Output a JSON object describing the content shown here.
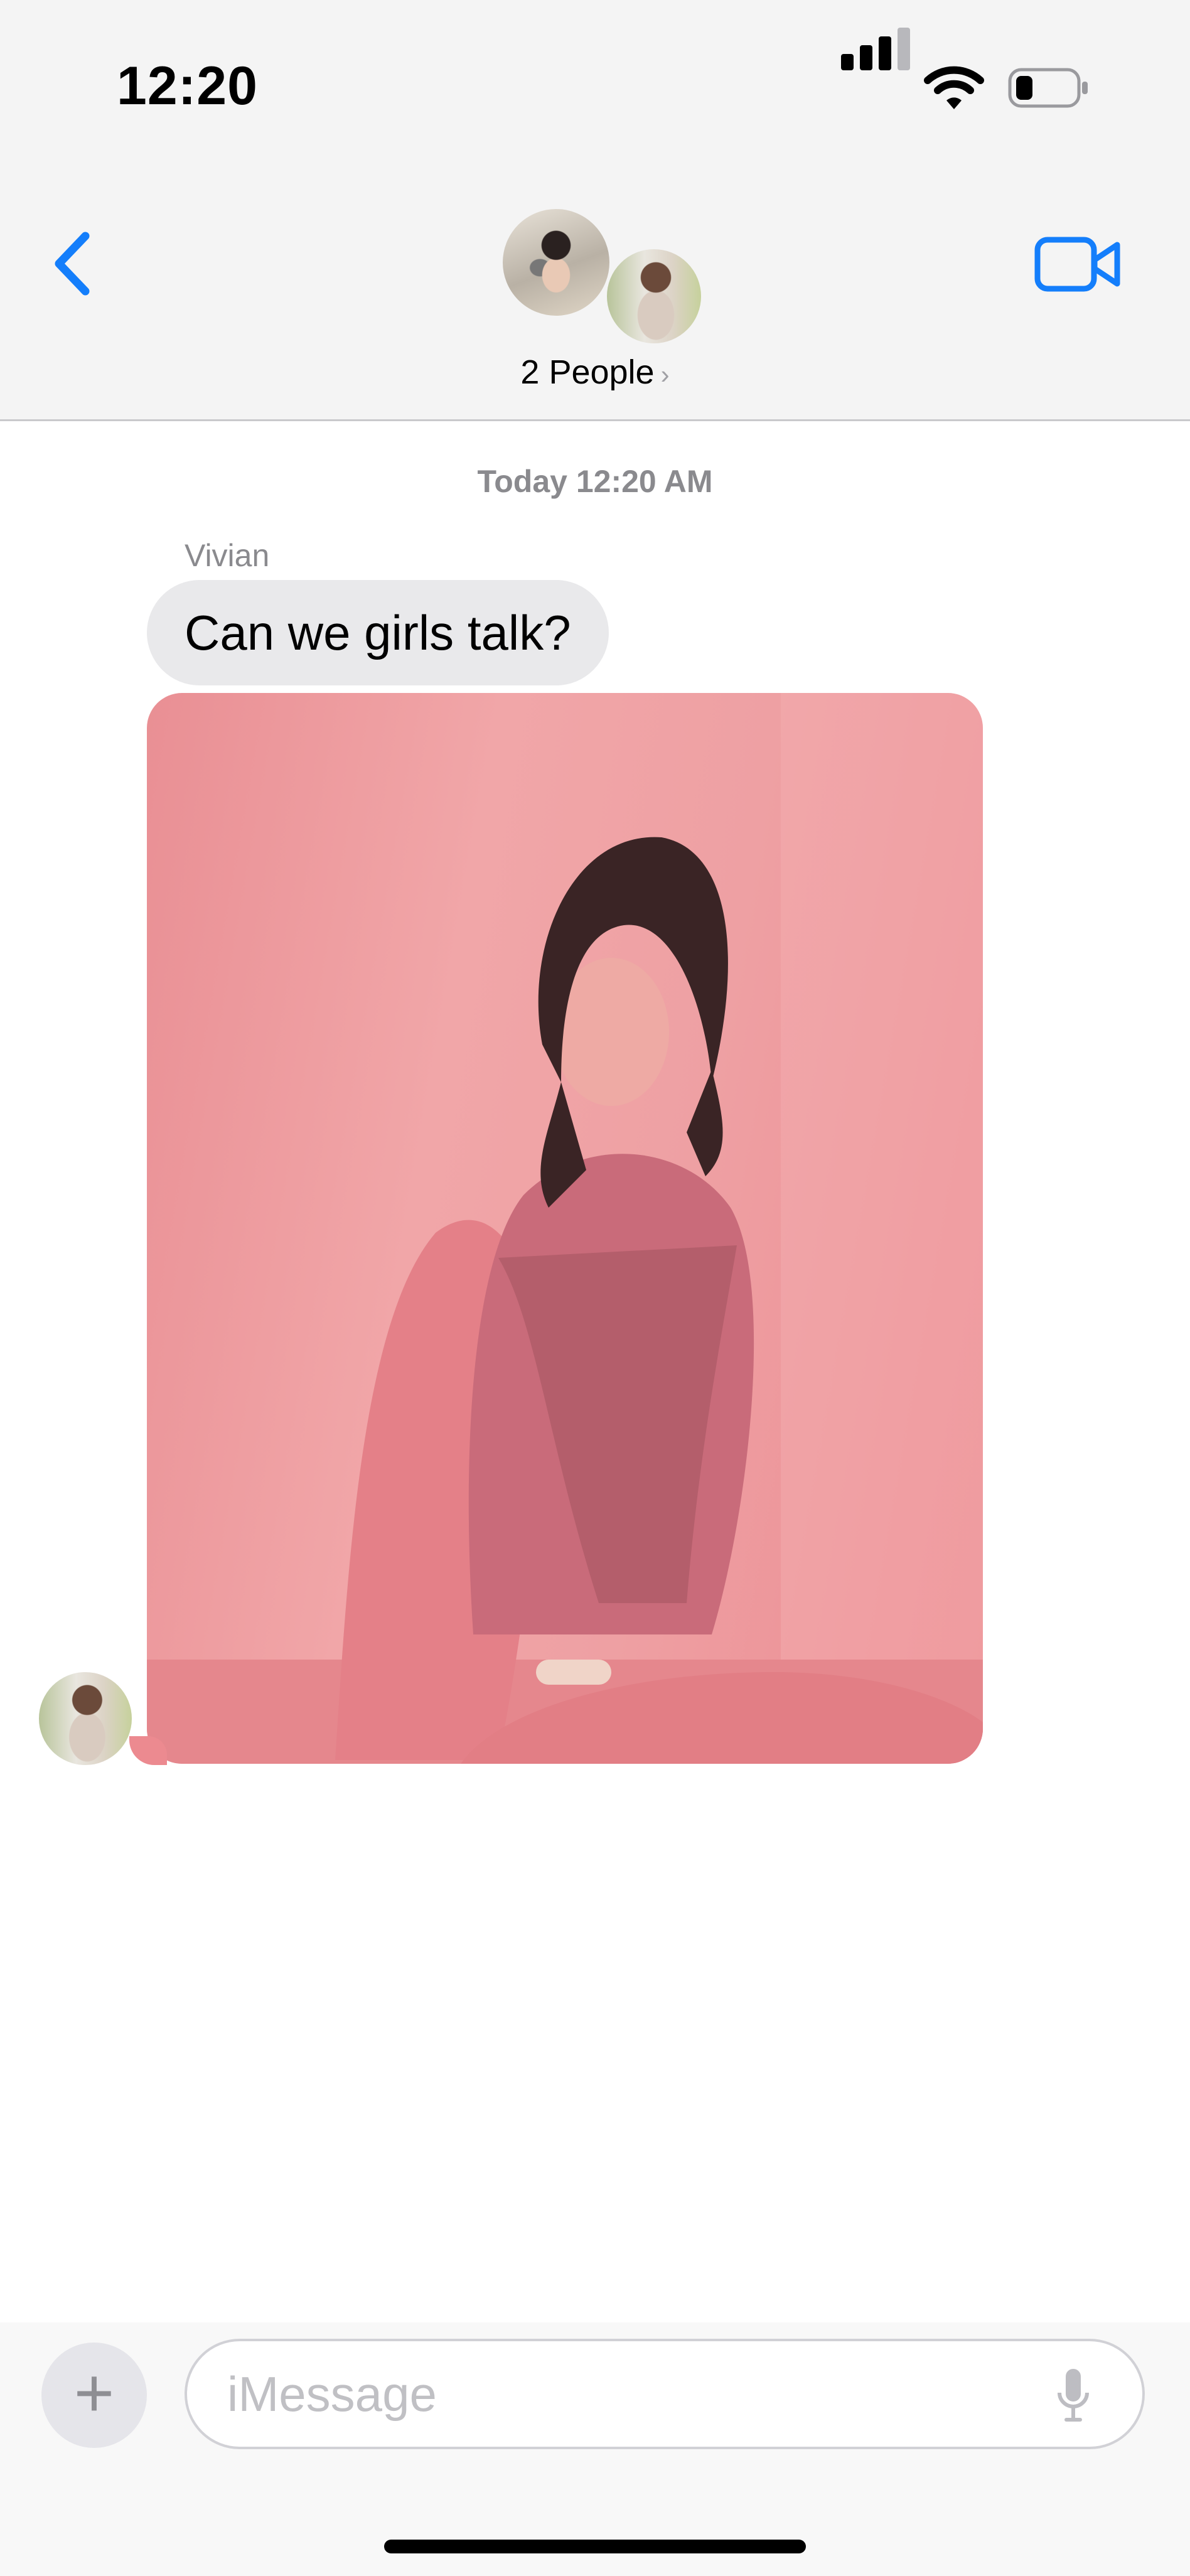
{
  "status_bar": {
    "time": "12:20"
  },
  "header": {
    "title": "2 People",
    "chevron": "›"
  },
  "conversation": {
    "timestamp": "Today 12:20 AM",
    "messages": [
      {
        "sender": "Vivian",
        "text": "Can we girls talk?"
      },
      {
        "sender": "Vivian",
        "type": "image"
      }
    ]
  },
  "composer": {
    "placeholder": "iMessage",
    "plus": "+"
  },
  "colors": {
    "accent": "#147EFB",
    "bubble_gray": "#E9E9EB"
  },
  "icons": [
    "back-chevron-icon",
    "video-camera-icon",
    "cellular-signal-icon",
    "wifi-icon",
    "battery-icon",
    "plus-icon",
    "microphone-icon"
  ]
}
